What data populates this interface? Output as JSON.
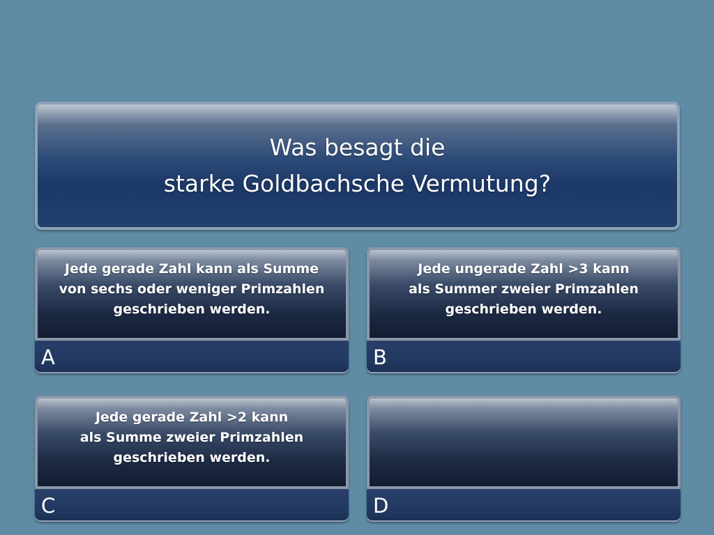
{
  "question": {
    "text": "Was besagt die\nstarke Goldbachsche Vermutung?"
  },
  "answers": [
    {
      "letter": "A",
      "text": "Jede gerade Zahl kann als Summe\nvon sechs oder weniger Primzahlen\ngeschrieben werden."
    },
    {
      "letter": "B",
      "text": "Jede ungerade Zahl >3 kann\nals Summer zweier Primzahlen\ngeschrieben werden."
    },
    {
      "letter": "C",
      "text": "Jede gerade Zahl >2 kann\nals Summe zweier Primzahlen\ngeschrieben werden."
    },
    {
      "letter": "D",
      "text": ""
    }
  ],
  "colors": {
    "background": "#5f8ba5",
    "panel_dark": "#1c3866",
    "letter_bar": "#223961",
    "text": "#ffffff"
  }
}
